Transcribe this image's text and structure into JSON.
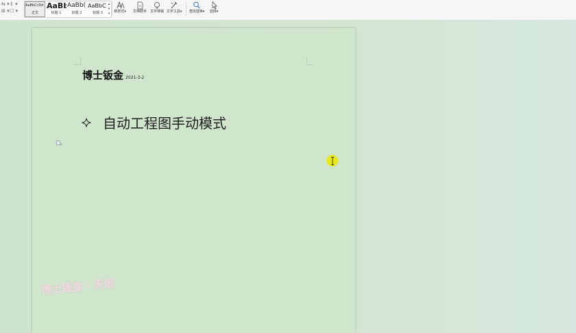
{
  "ribbon": {
    "styles": [
      {
        "preview": "AaBbCcDd",
        "name": "正文",
        "selected": true
      },
      {
        "preview": "AaBb",
        "name": "标题 1"
      },
      {
        "preview": "AaBb(",
        "name": "标题 2"
      },
      {
        "preview": "AaBbC",
        "name": "标题 3"
      }
    ],
    "tools": [
      {
        "label": "新样式▾",
        "icon": "new-style-icon"
      },
      {
        "label": "文档助手",
        "icon": "doc-assistant-icon"
      },
      {
        "label": "文字排版",
        "icon": "typesetting-icon"
      },
      {
        "label": "文字工具▾",
        "icon": "text-tools-icon"
      },
      {
        "label": "查找替换▾",
        "icon": "find-replace-icon"
      },
      {
        "label": "选择▾",
        "icon": "select-cursor-icon"
      }
    ]
  },
  "document": {
    "title": "博士钣金",
    "date": "2021-3-2",
    "bullet_symbol": "four-point-star-icon",
    "heading": "自动工程图手动模式"
  },
  "watermark": "博士钣金 - 天创",
  "colors": {
    "page_background": "#cfe5cc",
    "cursor_highlight": "#e7e81c",
    "ribbon_background": "#f5f6f6"
  }
}
